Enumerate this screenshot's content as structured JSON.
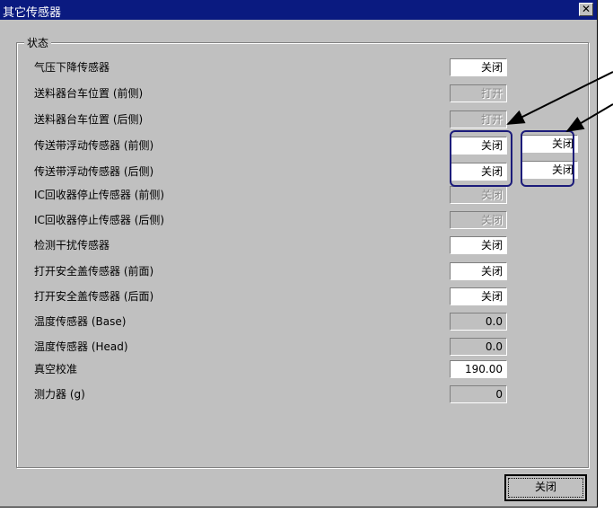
{
  "window": {
    "title": "其它传感器",
    "close_glyph": "✕"
  },
  "group": {
    "title": "状态"
  },
  "rows": [
    {
      "label": "气压下降传感器",
      "value": "关闭",
      "state": "enabled"
    },
    {
      "label": "送料器台车位置 (前侧)",
      "value": "打开",
      "state": "disabled"
    },
    {
      "label": "送料器台车位置 (后侧)",
      "value": "打开",
      "state": "disabled"
    },
    {
      "label": "传送带浮动传感器 (前侧)",
      "value": "关闭",
      "state": "enabled"
    },
    {
      "label": "传送带浮动传感器 (后侧)",
      "value": "关闭",
      "state": "enabled"
    },
    {
      "label": "IC回收器停止传感器 (前侧)",
      "value": "关闭",
      "state": "disabled"
    },
    {
      "label": "IC回收器停止传感器 (后侧)",
      "value": "关闭",
      "state": "disabled"
    },
    {
      "label": "检测干扰传感器",
      "value": "关闭",
      "state": "enabled"
    },
    {
      "label": "打开安全盖传感器 (前面)",
      "value": "关闭",
      "state": "enabled"
    },
    {
      "label": "打开安全盖传感器 (后面)",
      "value": "关闭",
      "state": "enabled"
    },
    {
      "label": "温度传感器 (Base)",
      "value": "0.0",
      "state": "readonly"
    },
    {
      "label": "温度传感器 (Head)",
      "value": "0.0",
      "state": "readonly"
    },
    {
      "label": "真空校准",
      "value": "190.00",
      "state": "enabled"
    },
    {
      "label": "测力器 (g)",
      "value": "0",
      "state": "readonly"
    }
  ],
  "extra_fields": [
    {
      "value": "关闭",
      "state": "enabled"
    },
    {
      "value": "关闭",
      "state": "enabled"
    }
  ],
  "footer": {
    "close_label": "关闭"
  },
  "colors": {
    "titlebar": "#0a1a80",
    "highlight": "#1c1c7a",
    "dialog": "#c0c0c0"
  }
}
